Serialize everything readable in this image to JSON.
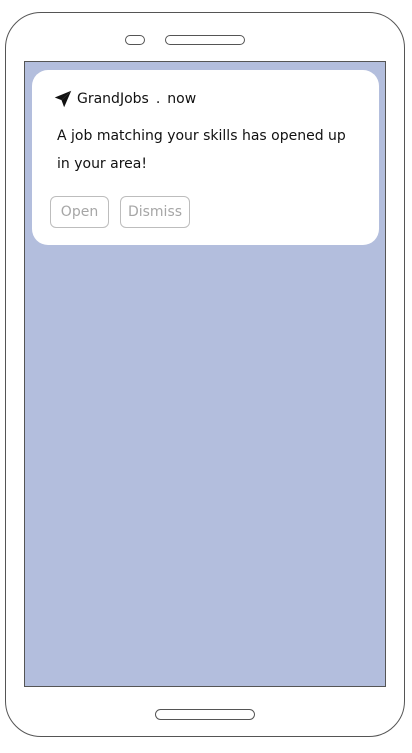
{
  "notification": {
    "app_name": "GrandJobs",
    "separator": ".",
    "time": "now",
    "message": "A job matching your skills has opened up in your area!",
    "icon": "send-icon",
    "actions": {
      "open_label": "Open",
      "dismiss_label": "Dismiss"
    }
  },
  "colors": {
    "screen_background": "#b3bedd",
    "card_background": "#ffffff",
    "button_text": "#a6a6a6",
    "button_border": "#bdbdbd",
    "device_outline": "#555555"
  }
}
